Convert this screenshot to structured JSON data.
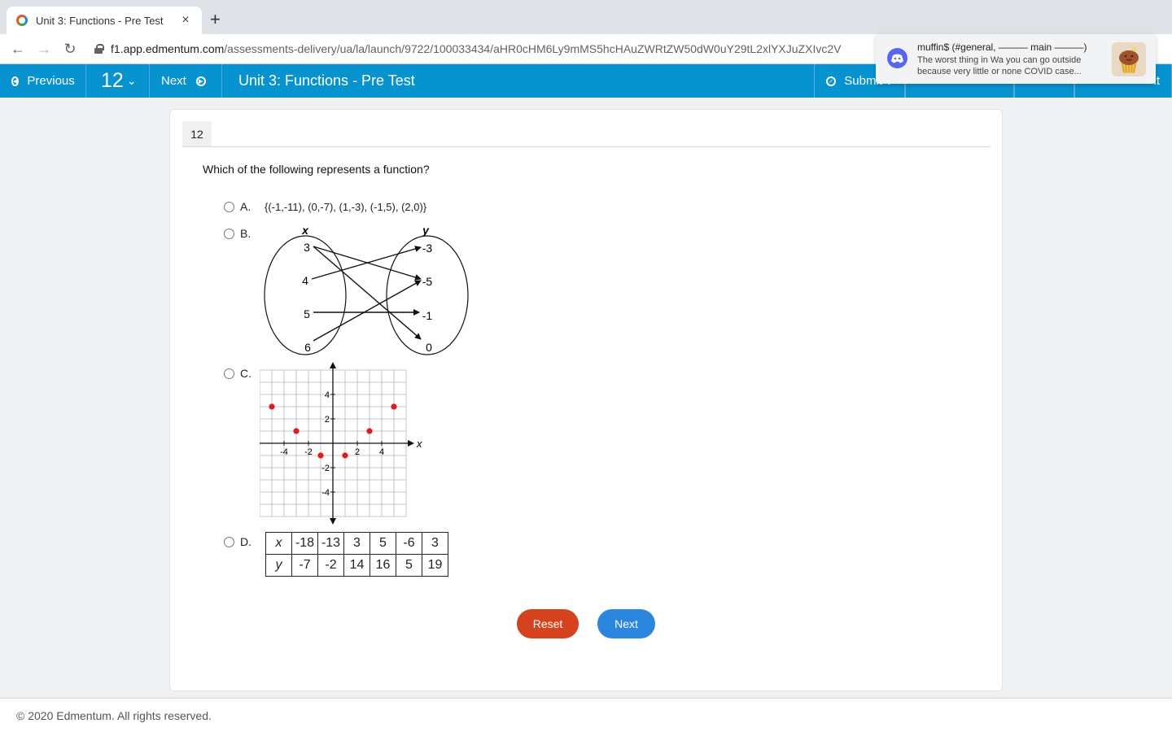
{
  "browser": {
    "tab_title": "Unit 3: Functions - Pre Test",
    "tab_close": "×",
    "new_tab": "+",
    "url_host": "f1.app.edmentum.com",
    "url_path": "/assessments-delivery/ua/la/launch/9722/100033434/aHR0cHM6Ly9mMS5hcHAuZWRtZW50dW0uY29tL2xlYXJuZXIvc2V"
  },
  "toolbar": {
    "previous_label": "Previous",
    "question_number": "12",
    "next_label": "Next",
    "title": "Unit 3: Functions - Pre Test",
    "submit_label": "Submit T",
    "exit_label": "it"
  },
  "question": {
    "number": "12",
    "prompt": "Which of the following represents a function?",
    "options": [
      {
        "letter": "A.",
        "text": "{(-1,-11), (0,-7), (1,-3), (-1,5), (2,0)}"
      },
      {
        "letter": "B."
      },
      {
        "letter": "C."
      },
      {
        "letter": "D."
      }
    ]
  },
  "mapping": {
    "x_label": "x",
    "y_label": "y",
    "domain": [
      "3",
      "4",
      "5",
      "6"
    ],
    "range": [
      "-3",
      "-5",
      "-1",
      "0"
    ],
    "arrows": [
      [
        "3",
        "-5"
      ],
      [
        "3",
        "0"
      ],
      [
        "4",
        "-3"
      ],
      [
        "5",
        "-1"
      ],
      [
        "6",
        "-5"
      ]
    ]
  },
  "chart_data": {
    "type": "scatter",
    "xlabel": "x",
    "ylabel": "y",
    "xlim": [
      -6,
      6
    ],
    "ylim": [
      -6,
      6
    ],
    "grid": true,
    "x_ticks": [
      "-4",
      "-2",
      "2",
      "4"
    ],
    "y_ticks": [
      "4",
      "2",
      "-2",
      "-4"
    ],
    "x": [
      -5,
      -3,
      -1,
      1,
      3,
      5
    ],
    "y": [
      3,
      1,
      -1,
      -1,
      1,
      3
    ],
    "point_color": "#e01b1b"
  },
  "table": {
    "x_header": "x",
    "y_header": "y",
    "x_values": [
      "-18",
      "-13",
      "3",
      "5",
      "-6",
      "3"
    ],
    "y_values": [
      "-7",
      "-2",
      "14",
      "16",
      "5",
      "19"
    ]
  },
  "buttons": {
    "reset": "Reset",
    "next": "Next"
  },
  "footer": {
    "copyright": "© 2020 Edmentum. All rights reserved."
  },
  "notification": {
    "header": "muffin$ (#general, ——— main ———)",
    "body": "The worst thing in Wa you can go outside because very little or none COVID  case..."
  },
  "colors": {
    "toolbar_blue": "#0792d0",
    "reset_red": "#d4421e",
    "next_blue": "#2b87dd",
    "discord": "#5865f2"
  }
}
